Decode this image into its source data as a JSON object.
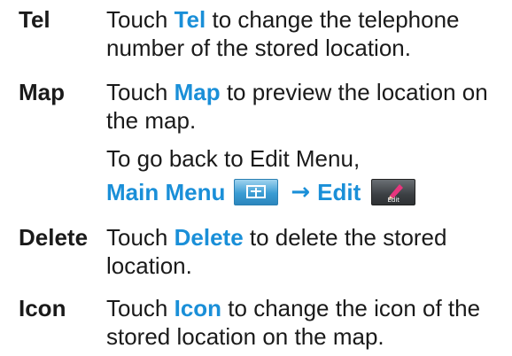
{
  "entries": [
    {
      "term": "Tel",
      "desc_before": "Touch ",
      "highlight": "Tel",
      "desc_after": " to change the telephone number of the stored location."
    },
    {
      "term": "Map",
      "desc_before": "Touch ",
      "highlight": "Map",
      "desc_after": " to preview the location on the map.",
      "note": "To go back to Edit Menu,"
    },
    {
      "term": "Delete",
      "desc_before": "Touch ",
      "highlight": "Delete",
      "desc_after": " to delete the stored location."
    },
    {
      "term": "Icon",
      "desc_before": "Touch ",
      "highlight": "Icon",
      "desc_after": " to change the icon of the stored location on the map."
    }
  ],
  "navigation": {
    "main_menu_label": "Main Menu",
    "main_menu_icon": "main-menu-icon",
    "arrow": "→",
    "edit_label": "Edit",
    "edit_icon": "edit-pencil-icon",
    "edit_button_caption": "Edit"
  },
  "colors": {
    "highlight": "#1a8fd8",
    "text": "#1a1a1a"
  }
}
